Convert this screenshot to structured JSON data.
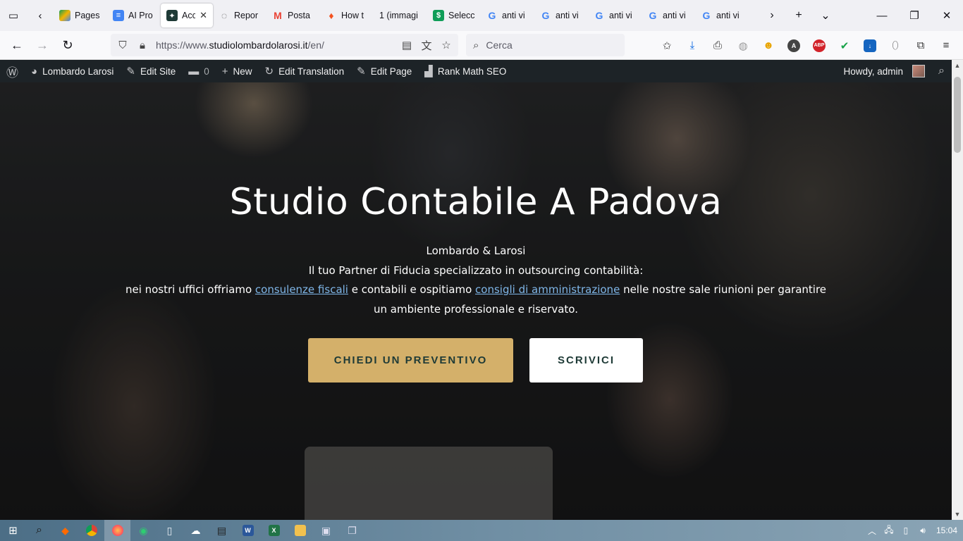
{
  "tabs": [
    {
      "title": "Pages",
      "favicon": "google-drive-icon",
      "color": "#1a73e8"
    },
    {
      "title": "AI Pro",
      "favicon": "google-docs-icon",
      "color": "#4285f4"
    },
    {
      "title": "Acc",
      "favicon": "site-favicon",
      "color": "#1e3a36",
      "active": true
    },
    {
      "title": "Repor",
      "favicon": "loading-icon",
      "color": "#888888"
    },
    {
      "title": "Posta",
      "favicon": "gmail-icon",
      "color": "#ea4335"
    },
    {
      "title": "How t",
      "favicon": "flame-icon",
      "color": "#f4511e"
    },
    {
      "title": "1 (immagi",
      "favicon": "",
      "color": "#888888"
    },
    {
      "title": "Selecc",
      "favicon": "sheets-icon",
      "color": "#0f9d58"
    },
    {
      "title": "anti vi",
      "favicon": "google-icon",
      "color": "#4285f4"
    },
    {
      "title": "anti vi",
      "favicon": "google-icon",
      "color": "#4285f4"
    },
    {
      "title": "anti vi",
      "favicon": "google-icon",
      "color": "#4285f4"
    },
    {
      "title": "anti vi",
      "favicon": "google-icon",
      "color": "#4285f4"
    },
    {
      "title": "anti vi",
      "favicon": "google-icon",
      "color": "#4285f4"
    }
  ],
  "nav": {
    "url_prefix": "https://www.",
    "url_domain": "studiolombardolarosi.it",
    "url_path": "/en/",
    "search_placeholder": "Cerca"
  },
  "adminbar": {
    "site_name": "Lombardo Larosi",
    "edit_site": "Edit Site",
    "comments_count": "0",
    "new": "New",
    "edit_translation": "Edit Translation",
    "edit_page": "Edit Page",
    "rank_math": "Rank Math SEO",
    "howdy": "Howdy, admin"
  },
  "hero": {
    "title": "Studio Contabile A Padova",
    "line1": "Lombardo & Larosi",
    "line2": "Il tuo Partner di Fiducia specializzato in outsourcing contabilità:",
    "line3_a": "nei nostri uffici offriamo ",
    "link1": "consulenze fiscali",
    "line3_b": " e contabili e ospitiamo ",
    "link2": "consigli di amministrazione",
    "line3_c": " nelle nostre sale riunioni per garantire",
    "line4": "un ambiente professionale e riservato.",
    "btn_primary": "CHIEDI UN PREVENTIVO",
    "btn_secondary": "SCRIVICI"
  },
  "taskbar": {
    "clock": "15:04"
  },
  "colors": {
    "gold": "#d4b06a",
    "dark_green": "#1e3a36",
    "admin_bar": "#1d2327"
  }
}
